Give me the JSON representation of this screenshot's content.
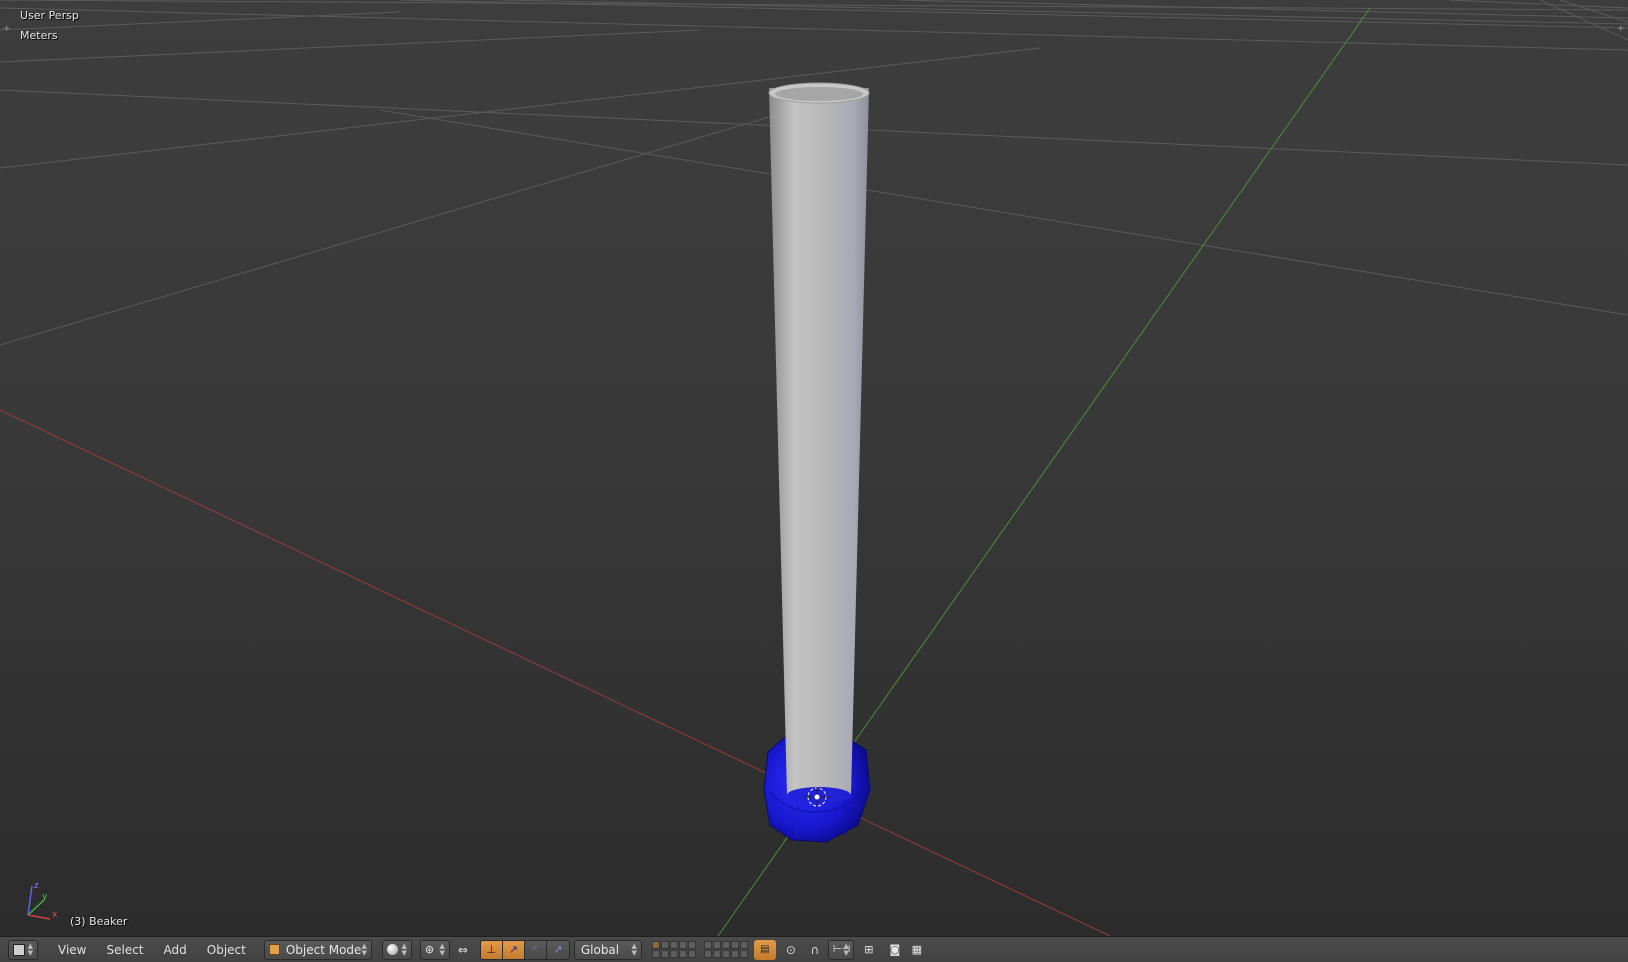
{
  "viewport": {
    "view_name": "User Persp",
    "units": "Meters",
    "object_info": "(3) Beaker",
    "colors": {
      "background": "#393939",
      "grid": "#555555",
      "x_axis": "#a33a3a",
      "y_axis": "#4a9a3a",
      "cylinder": "#bcbcbc",
      "base": "#1414c8"
    }
  },
  "header": {
    "editor_icon": "cube-icon",
    "menus": [
      "View",
      "Select",
      "Add",
      "Object"
    ],
    "mode": "Object Mode",
    "transform_orientation": "Global"
  }
}
